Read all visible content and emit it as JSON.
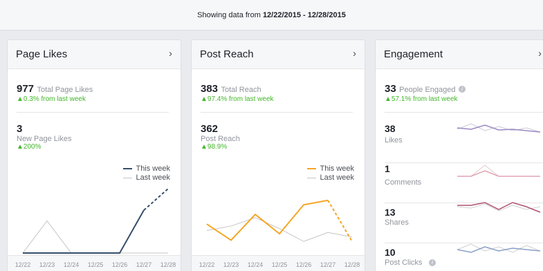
{
  "banner": {
    "prefix": "Showing data from",
    "range": "12/22/2015 - 12/28/2015"
  },
  "cards": {
    "page_likes": {
      "title": "Page Likes",
      "total_value": "977",
      "total_label": "Total Page Likes",
      "total_change": "0.3% from last week",
      "new_value": "3",
      "new_label": "New Page Likes",
      "new_change": "200%",
      "legend_this": "This week",
      "legend_last": "Last week",
      "colors": {
        "this_week": "#364e6e",
        "last_week": "#c4c4c4"
      }
    },
    "post_reach": {
      "title": "Post Reach",
      "total_value": "383",
      "total_label": "Total Reach",
      "total_change": "97.4% from last week",
      "reach_value": "362",
      "reach_label": "Post Reach",
      "reach_change": "98.9%",
      "legend_this": "This week",
      "legend_last": "Last week",
      "colors": {
        "this_week": "#f5a623",
        "last_week": "#c4c4c4"
      }
    },
    "engagement": {
      "title": "Engagement",
      "people_value": "33",
      "people_label": "People Engaged",
      "people_change": "57.1% from last week",
      "rows": [
        {
          "value": "38",
          "label": "Likes"
        },
        {
          "value": "1",
          "label": "Comments"
        },
        {
          "value": "13",
          "label": "Shares"
        },
        {
          "value": "10",
          "label": "Post Clicks"
        }
      ]
    }
  },
  "chart_data": [
    {
      "type": "line",
      "x": [
        "12/22",
        "12/23",
        "12/24",
        "12/25",
        "12/26",
        "12/27",
        "12/28"
      ],
      "series": [
        {
          "name": "This week",
          "values": [
            0,
            0,
            0,
            0,
            0,
            2,
            3
          ]
        },
        {
          "name": "Last week",
          "values": [
            0,
            1.5,
            0,
            0,
            0,
            0,
            0
          ]
        }
      ],
      "ylim": [
        0,
        3
      ]
    },
    {
      "type": "line",
      "x": [
        "12/22",
        "12/23",
        "12/24",
        "12/25",
        "12/26",
        "12/27",
        "12/28"
      ],
      "series": [
        {
          "name": "This week",
          "values": [
            45,
            20,
            60,
            30,
            75,
            82,
            18
          ]
        },
        {
          "name": "Last week",
          "values": [
            35,
            42,
            55,
            38,
            18,
            32,
            25
          ]
        }
      ],
      "ylim": [
        0,
        100
      ]
    }
  ]
}
